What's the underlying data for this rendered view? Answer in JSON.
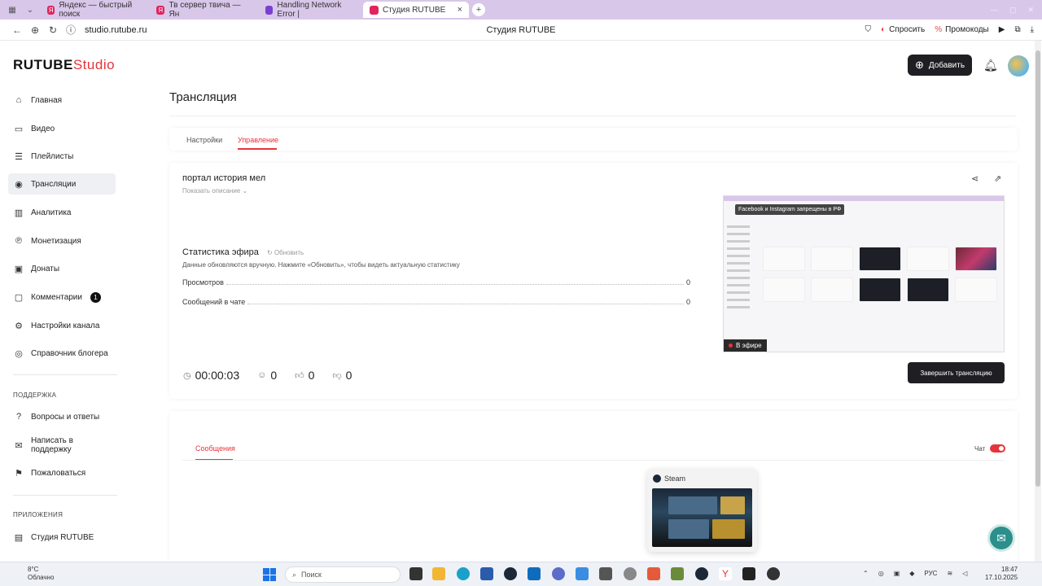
{
  "browser": {
    "tabs": [
      {
        "label": "Яндекс — быстрый поиск"
      },
      {
        "label": "Тв сервер твича — Ян"
      },
      {
        "label": "Handling Network Error |"
      },
      {
        "label": "Студия RUTUBE",
        "close": "×"
      }
    ],
    "new_tab": "+",
    "url": "studio.rutube.ru",
    "page_title": "Студия RUTUBE",
    "ask_label": "Спросить",
    "promo_label": "Промокоды"
  },
  "header": {
    "logo_main": "RUTUBE",
    "logo_studio": "Studio",
    "add_label": "Добавить"
  },
  "sidebar": {
    "items": [
      {
        "label": "Главная",
        "icon": "home-icon"
      },
      {
        "label": "Видео",
        "icon": "video-icon"
      },
      {
        "label": "Плейлисты",
        "icon": "playlist-icon"
      },
      {
        "label": "Трансляции",
        "icon": "broadcast-icon"
      },
      {
        "label": "Аналитика",
        "icon": "analytics-icon"
      },
      {
        "label": "Монетизация",
        "icon": "money-icon"
      },
      {
        "label": "Донаты",
        "icon": "donate-icon"
      },
      {
        "label": "Комментарии",
        "icon": "comment-icon",
        "badge": "1"
      },
      {
        "label": "Настройки канала",
        "icon": "settings-icon"
      },
      {
        "label": "Справочник блогера",
        "icon": "book-icon"
      }
    ],
    "support_title": "ПОДДЕРЖКА",
    "support_items": [
      {
        "label": "Вопросы и ответы"
      },
      {
        "label": "Написать в поддержку"
      },
      {
        "label": "Пожаловаться"
      }
    ],
    "apps_title": "ПРИЛОЖЕНИЯ",
    "apps_items": [
      {
        "label": "Студия RUTUBE"
      }
    ]
  },
  "main": {
    "title": "Трансляция",
    "tabs": [
      {
        "label": "Настройки"
      },
      {
        "label": "Управление"
      }
    ],
    "stream": {
      "name": "портал история мел",
      "show_description": "Показать описание",
      "stats_title": "Статистика эфира",
      "refresh_label": "Обновить",
      "stats_note": "Данные обновляются вручную. Нажмите «Обновить», чтобы видеть актуальную статистику",
      "stats": [
        {
          "label": "Просмотров",
          "value": "0"
        },
        {
          "label": "Сообщений в чате",
          "value": "0"
        }
      ],
      "duration": "00:00:03",
      "viewers": "0",
      "likes": "0",
      "dislikes": "0",
      "end_label": "Завершить трансляцию",
      "preview_banner": "Facebook и Instagram запрещены в РФ",
      "live_label": "В эфире"
    },
    "messages_tab": "Сообщения",
    "chat_label": "Чат",
    "chat_enabled": true
  },
  "steam_popup": {
    "title": "Steam"
  },
  "taskbar": {
    "weather_temp": "8°C",
    "weather_desc": "Облачно",
    "search_placeholder": "Поиск",
    "lang": "РУС",
    "time": "18:47",
    "date": "17.10.2025"
  },
  "colors": {
    "accent": "#e8333a",
    "dark_button": "#1f1f23",
    "tabbar": "#d9c7ea"
  }
}
